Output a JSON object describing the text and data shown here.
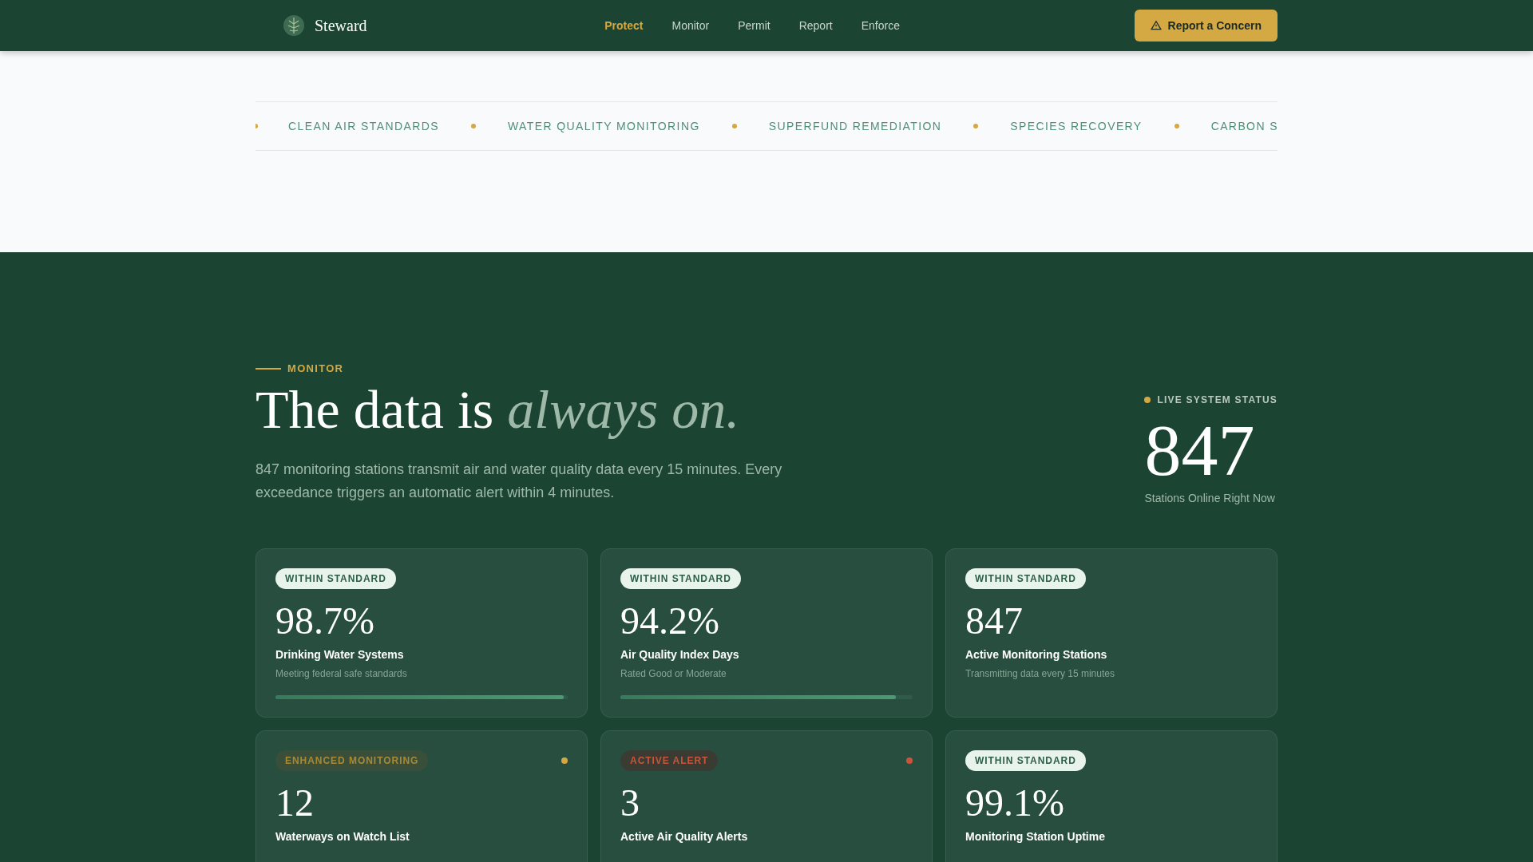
{
  "header": {
    "brand": "Steward",
    "nav": [
      {
        "label": "Protect",
        "selected": true
      },
      {
        "label": "Monitor",
        "selected": false
      },
      {
        "label": "Permit",
        "selected": false
      },
      {
        "label": "Report",
        "selected": false
      },
      {
        "label": "Enforce",
        "selected": false
      }
    ],
    "cta": "Report a Concern"
  },
  "ticker": [
    "CLEAN AIR STANDARDS",
    "WATER QUALITY MONITORING",
    "SUPERFUND REMEDIATION",
    "SPECIES RECOVERY",
    "CARBON S"
  ],
  "monitor": {
    "eyebrow": "MONITOR",
    "title": "The data is",
    "title_emphasis": "always on.",
    "description": "847 monitoring stations transmit air and water quality data every 15 minutes. Every exceedance triggers an automatic alert within 4 minutes.",
    "live": {
      "label": "LIVE SYSTEM STATUS",
      "value": "847",
      "caption": "Stations Online Right Now"
    }
  },
  "cards": [
    {
      "kind": "within",
      "badge": "WITHIN STANDARD",
      "value": "98.7%",
      "label": "Drinking Water Systems",
      "note": "Meeting federal safe standards",
      "level": 0.987
    },
    {
      "kind": "within",
      "badge": "WITHIN STANDARD",
      "value": "94.2%",
      "label": "Air Quality Index Days",
      "note": "Rated Good or Moderate",
      "level": 0.942
    },
    {
      "kind": "within",
      "badge": "WITHIN STANDARD",
      "value": "847",
      "label": "Active Monitoring Stations",
      "note": "Transmitting data every 15 minutes"
    },
    {
      "kind": "enhanced",
      "badge": "ENHANCED MONITORING",
      "color": "#d4a843",
      "value": "12",
      "label": "Waterways on Watch List"
    },
    {
      "kind": "alert",
      "badge": "ACTIVE ALERT",
      "color": "#c8553a",
      "value": "3",
      "label": "Active Air Quality Alerts"
    },
    {
      "kind": "within",
      "badge": "WITHIN STANDARD",
      "value": "99.1%",
      "label": "Monitoring Station Uptime"
    }
  ]
}
